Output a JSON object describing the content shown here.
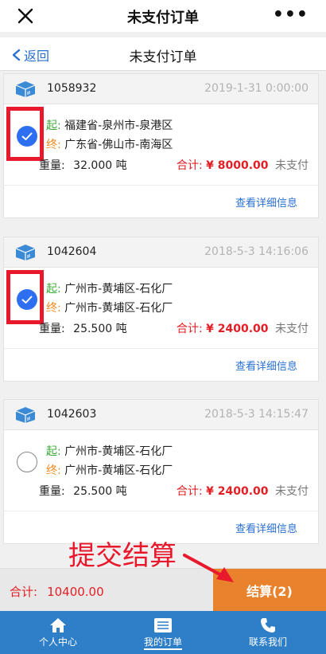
{
  "window": {
    "title": "未支付订单",
    "close_icon": "close-icon",
    "more_label": "•••"
  },
  "nav": {
    "back_label": "返回",
    "title": "未支付订单"
  },
  "labels": {
    "start": "起:",
    "end": "终:",
    "weight": "重量:",
    "total": "合计:",
    "detail": "查看详细信息"
  },
  "orders": [
    {
      "id": "1058932",
      "date": "2019-1-31 0:00:00",
      "checked": true,
      "highlighted": true,
      "from": "福建省-泉州市-泉港区",
      "to": "广东省-佛山市-南海区",
      "weight": "32.000 吨",
      "total": "¥ 8000.00",
      "status": "未支付"
    },
    {
      "id": "1042604",
      "date": "2018-5-3 14:16:06",
      "checked": true,
      "highlighted": true,
      "from": "广州市-黄埔区-石化厂",
      "to": "广州市-黄埔区-石化厂",
      "weight": "25.500 吨",
      "total": "¥ 2400.00",
      "status": "未支付"
    },
    {
      "id": "1042603",
      "date": "2018-5-3 14:15:47",
      "checked": false,
      "highlighted": false,
      "from": "广州市-黄埔区-石化厂",
      "to": "广州市-黄埔区-石化厂",
      "weight": "25.500 吨",
      "total": "¥ 2400.00",
      "status": "未支付"
    }
  ],
  "summary": {
    "total_label": "合计:",
    "total_value": "10400.00",
    "checkout_label": "结算(2)"
  },
  "annotation": {
    "text": "提交结算",
    "color": "#e8192c"
  },
  "tabs": [
    {
      "label": "个人中心",
      "icon": "home-icon"
    },
    {
      "label": "我的订单",
      "icon": "list-icon",
      "active": true
    },
    {
      "label": "联系我们",
      "icon": "phone-icon"
    }
  ],
  "colors": {
    "accent": "#2a6fd4",
    "checkout": "#e9822c",
    "tabbar": "#2f7fc8",
    "price": "#e31e24"
  }
}
